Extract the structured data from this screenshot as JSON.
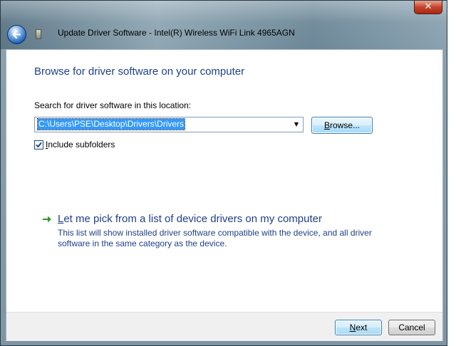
{
  "window": {
    "title": "Update Driver Software - Intel(R) Wireless WiFi Link 4965AGN",
    "close_glyph": "✕"
  },
  "main": {
    "heading": "Browse for driver software on your computer",
    "search_label": "Search for driver software in this location:",
    "path_value": "C:\\Users\\PSE\\Desktop\\Drivers\\Drivers",
    "browse_label_prefix": "B",
    "browse_label_rest": "rowse...",
    "include_subfolders_checked": true,
    "include_subfolders_prefix": "I",
    "include_subfolders_rest": "nclude subfolders",
    "pick_title_prefix": "L",
    "pick_title_rest": "et me pick from a list of device drivers on my computer",
    "pick_description": "This list will show installed driver software compatible with the device, and all driver software in the same category as the device."
  },
  "footer": {
    "next_prefix": "N",
    "next_rest": "ext",
    "cancel_label": "Cancel"
  },
  "colors": {
    "accent_text": "#1e3f8a",
    "selection": "#3399ff",
    "link_arrow": "#2e9a2e"
  },
  "icons": [
    "back-arrow-icon",
    "device-icon",
    "close-icon",
    "dropdown-arrow-icon",
    "checkmark-icon",
    "green-arrow-icon"
  ]
}
